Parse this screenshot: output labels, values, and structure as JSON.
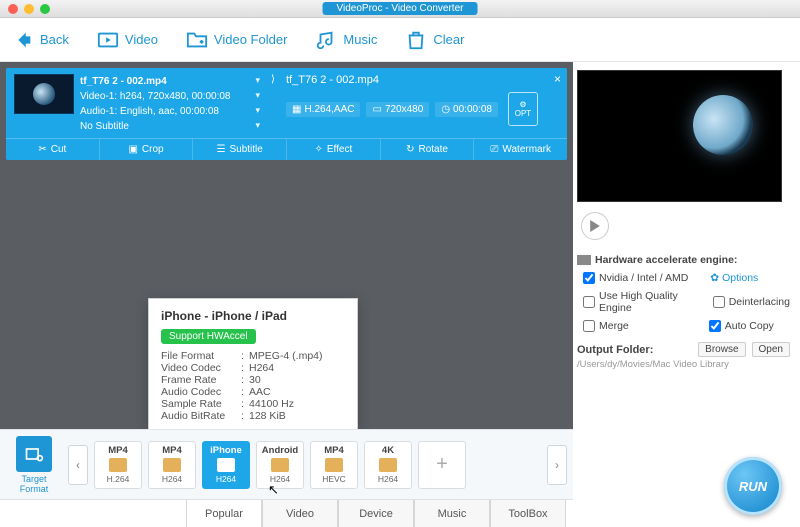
{
  "app_title": "VideoProc - Video Converter",
  "toolbar": {
    "back": "Back",
    "video": "Video",
    "video_folder": "Video Folder",
    "music": "Music",
    "clear": "Clear"
  },
  "item": {
    "src_filename": "tf_T76 2 - 002.mp4",
    "video_line": "Video-1: h264, 720x480, 00:00:08",
    "audio_line": "Audio-1: English, aac, 00:00:08",
    "subtitle_line": "No Subtitle",
    "out_filename": "tf_T76 2 - 002.mp4",
    "codec": "H.264,AAC",
    "resolution": "720x480",
    "duration": "00:00:08",
    "opt_label": "OPT",
    "edits": {
      "cut": "Cut",
      "crop": "Crop",
      "subtitle": "Subtitle",
      "effect": "Effect",
      "rotate": "Rotate",
      "watermark": "Watermark"
    }
  },
  "tooltip": {
    "title": "iPhone - iPhone / iPad",
    "hwaccel": "Support HWAccel",
    "rows": [
      {
        "k": "File Format",
        "v": "MPEG-4 (.mp4)"
      },
      {
        "k": "Video Codec",
        "v": "H264"
      },
      {
        "k": "Frame Rate",
        "v": "30"
      },
      {
        "k": "Audio Codec",
        "v": "AAC"
      },
      {
        "k": "Sample Rate",
        "v": "44100 Hz"
      },
      {
        "k": "Audio BitRate",
        "v": "128 KiB"
      }
    ]
  },
  "target_format_label": "Target Format",
  "formats": [
    {
      "top": "MP4",
      "sub": "H.264"
    },
    {
      "top": "MP4",
      "sub": "H264"
    },
    {
      "top": "iPhone",
      "sub": "H264"
    },
    {
      "top": "Android",
      "sub": "H264"
    },
    {
      "top": "MP4",
      "sub": "HEVC"
    },
    {
      "top": "4K",
      "sub": "H264"
    }
  ],
  "bottom_tabs": [
    "Popular",
    "Video",
    "Device",
    "Music",
    "ToolBox"
  ],
  "panel": {
    "hw_header": "Hardware accelerate engine:",
    "nvidia": "Nvidia / Intel / AMD",
    "options": "Options",
    "hq": "Use High Quality Engine",
    "deint": "Deinterlacing",
    "merge": "Merge",
    "autocopy": "Auto Copy",
    "out_label": "Output Folder:",
    "browse": "Browse",
    "open": "Open",
    "out_path": "/Users/dy/Movies/Mac Video Library"
  },
  "run_label": "RUN"
}
